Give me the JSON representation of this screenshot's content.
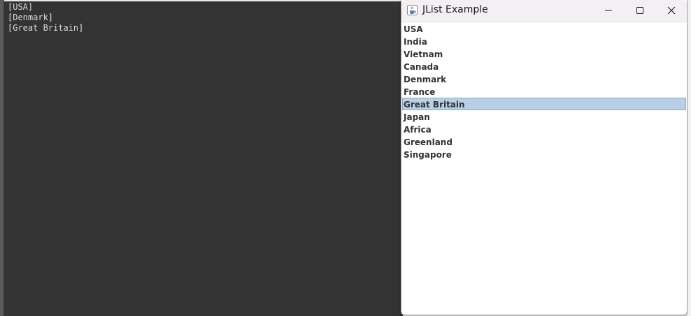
{
  "console": {
    "lines": [
      "[USA]",
      "[Denmark]",
      "[Great Britain]"
    ]
  },
  "window": {
    "title": "JList Example",
    "icon": "java-cup-icon",
    "controls": {
      "minimize_icon": "minimize-icon",
      "maximize_icon": "maximize-icon",
      "close_icon": "close-icon"
    }
  },
  "list": {
    "items": [
      {
        "label": "USA",
        "selected": false
      },
      {
        "label": "India",
        "selected": false
      },
      {
        "label": "Vietnam",
        "selected": false
      },
      {
        "label": "Canada",
        "selected": false
      },
      {
        "label": "Denmark",
        "selected": false
      },
      {
        "label": "France",
        "selected": false
      },
      {
        "label": "Great Britain",
        "selected": true
      },
      {
        "label": "Japan",
        "selected": false
      },
      {
        "label": "Africa",
        "selected": false
      },
      {
        "label": "Greenland",
        "selected": false
      },
      {
        "label": "Singapore",
        "selected": false
      }
    ]
  },
  "colors": {
    "console_bg": "#333333",
    "console_text": "#dcdcdc",
    "selection_bg": "#b8cfe5",
    "selection_border": "#8ba9c7",
    "titlebar_bg": "#f3eff5"
  }
}
